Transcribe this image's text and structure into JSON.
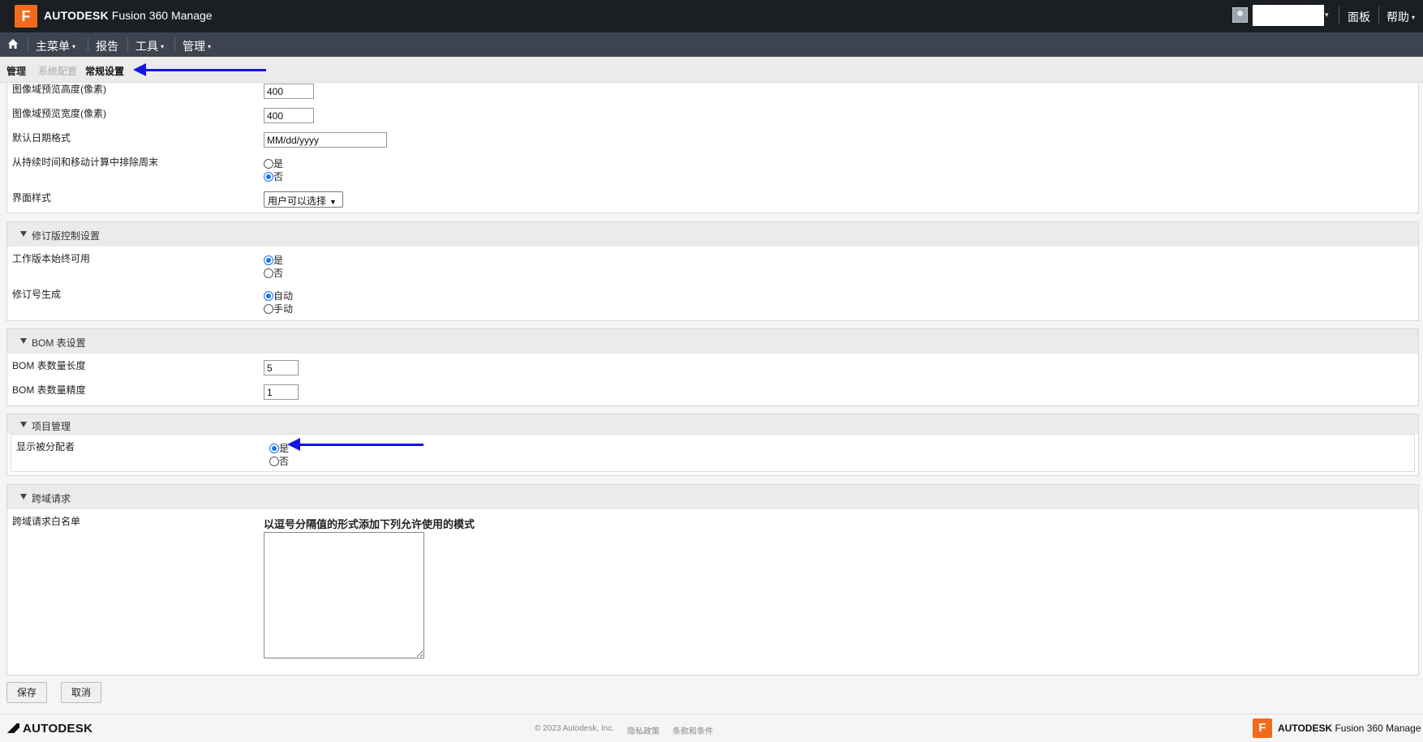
{
  "app": {
    "logo_letter": "F",
    "brand_bold": "AUTODESK",
    "brand_rest": " Fusion 360 Manage",
    "user_caret": "▾",
    "dashboard": "面板",
    "help": "帮助"
  },
  "nav": {
    "home_icon": "home-icon",
    "items": [
      {
        "label": "主菜单",
        "has_caret": true
      },
      {
        "label": "报告",
        "has_caret": false
      },
      {
        "label": "工具",
        "has_caret": true
      },
      {
        "label": "管理",
        "has_caret": true
      }
    ]
  },
  "breadcrumb": [
    "管理",
    "系统配置",
    "常规设置"
  ],
  "general": {
    "img_height_label": "图像域预览高度(像素)",
    "img_height_value": "400",
    "img_width_label": "图像域预览宽度(像素)",
    "img_width_value": "400",
    "date_format_label": "默认日期格式",
    "date_format_value": "MM/dd/yyyy",
    "exclude_weekend_label": "从持续时间和移动计算中排除周末",
    "exclude_weekend_options": [
      "是",
      "否"
    ],
    "exclude_weekend_selected": 1,
    "ui_style_label": "界面样式",
    "ui_style_value": "用户可以选择"
  },
  "revision": {
    "title": "修订版控制设置",
    "working_label": "工作版本始终可用",
    "working_options": [
      "是",
      "否"
    ],
    "working_selected": 0,
    "rev_gen_label": "修订号生成",
    "rev_gen_options": [
      "自动",
      "手动"
    ],
    "rev_gen_selected": 0
  },
  "bom": {
    "title": "BOM 表设置",
    "qty_length_label": "BOM 表数量长度",
    "qty_length_value": "5",
    "qty_precision_label": "BOM 表数量精度",
    "qty_precision_value": "1"
  },
  "project": {
    "title": "项目管理",
    "show_assignee_label": "显示被分配者",
    "show_assignee_options": [
      "是",
      "否"
    ],
    "show_assignee_selected": 0
  },
  "cors": {
    "title": "跨域请求",
    "whitelist_label": "跨域请求白名单",
    "hint": "以逗号分隔值的形式添加下列允许使用的模式",
    "whitelist_value": ""
  },
  "buttons": {
    "save": "保存",
    "cancel": "取消"
  },
  "footer": {
    "logo": "AUTODESK",
    "copyright": "© 2023 Autodesk, Inc.",
    "privacy": "隐私政策",
    "terms": "条款和条件",
    "brand_letter": "F",
    "brand_bold": "AUTODESK",
    "brand_rest": " Fusion 360 Manage"
  },
  "colors": {
    "accent": "#1a73e8",
    "brand_orange": "#f26b1d",
    "annotation_arrow": "#1414e6"
  }
}
